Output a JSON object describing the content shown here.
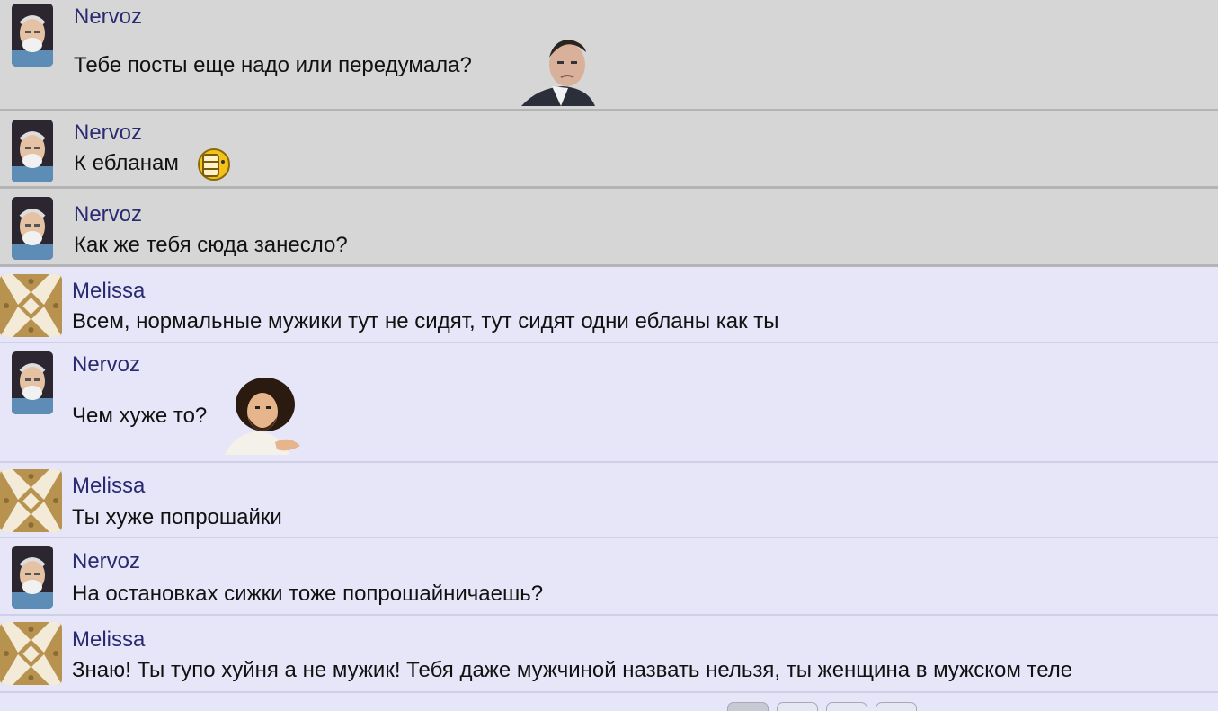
{
  "messages": [
    {
      "author": "Nervoz",
      "text": "Тебе посты еще надо или передумала?",
      "attachment": "man-in-suit-sticker"
    },
    {
      "author": "Nervoz",
      "text": "К ебланам",
      "attachment": "face-palm-smiley"
    },
    {
      "author": "Nervoz",
      "text": "Как же тебя сюда занесло?"
    },
    {
      "author": "Melissa",
      "text": "Всем, нормальные мужики тут не сидят, тут сидят одни ебланы как ты"
    },
    {
      "author": "Nervoz",
      "text": "Чем хуже то?",
      "attachment": "curly-hair-man-sticker"
    },
    {
      "author": "Melissa",
      "text": "Ты хуже попрошайки"
    },
    {
      "author": "Nervoz",
      "text": "На остановках сижки тоже попрошайничаешь?"
    },
    {
      "author": "Melissa",
      "text": "Знаю! Ты тупо хуйня а не мужик! Тебя даже мужчиной назвать нельзя, ты женщина в мужском теле"
    }
  ],
  "pagination": {
    "pages": [
      "",
      "",
      "",
      ""
    ]
  },
  "colors": {
    "own_bg": "#d6d6d6",
    "other_bg": "#e6e6f8",
    "author": "#2a2a72",
    "melissa_avatar": "#b8934f"
  }
}
